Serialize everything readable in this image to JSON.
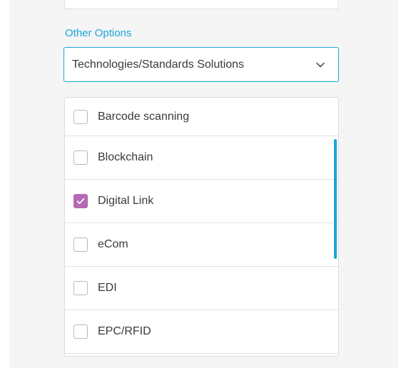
{
  "section": {
    "label": "Other Options"
  },
  "select": {
    "value": "Technologies/Standards Solutions",
    "icon": "chevron-down-icon"
  },
  "options": {
    "items": [
      {
        "label": "Barcode scanning",
        "checked": false
      },
      {
        "label": "Blockchain",
        "checked": false
      },
      {
        "label": "Digital Link",
        "checked": true
      },
      {
        "label": "eCom",
        "checked": false
      },
      {
        "label": "EDI",
        "checked": false
      },
      {
        "label": "EPC/RFID",
        "checked": false
      }
    ]
  },
  "colors": {
    "accent": "#1ba6d9",
    "checked": "#b36ab3",
    "text": "#3a3a3a"
  }
}
